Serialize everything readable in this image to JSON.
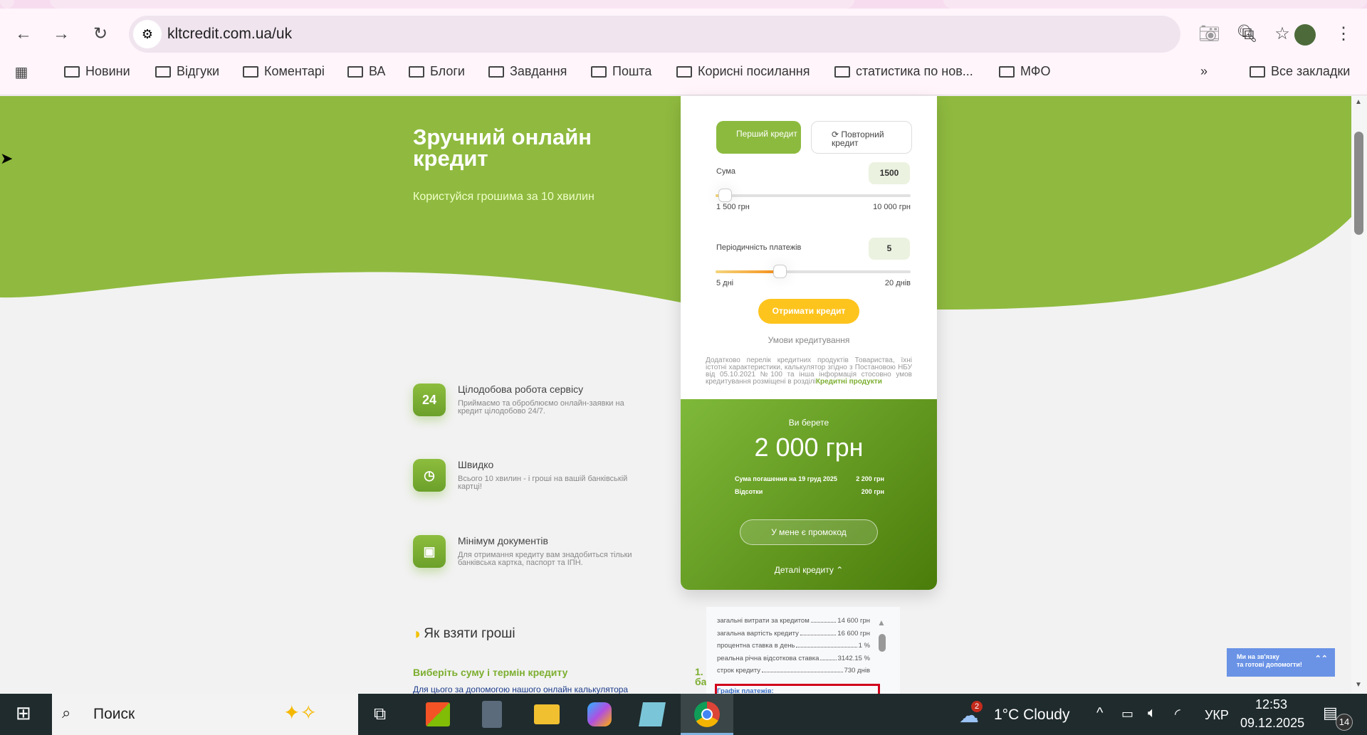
{
  "browser": {
    "url": "kltcredit.com.ua/uk",
    "bookmarks": [
      "Новини",
      "Відгуки",
      "Коментарі",
      "ВА",
      "Блоги",
      "Завдання",
      "Пошта",
      "Корисні посилання",
      "статистика по нов...",
      "МФО"
    ],
    "all_bookmarks": "Все закладки",
    "more": "»"
  },
  "hero": {
    "title": "Зручний онлайн кредит",
    "subtitle": "Користуйся грошима за 10 хвилин",
    "brand_color": "#8fba3f"
  },
  "features": [
    {
      "title": "Цілодобова робота сервісу",
      "desc": "Приймаємо та оброблюємо онлайн-заявки на кредит цілодобово 24/7.",
      "icon": "24h-icon",
      "glyph": "24"
    },
    {
      "title": "Швидко",
      "desc": "Всього 10 хвилин - і гроші на вашій банківській картці!",
      "icon": "fast-clock-icon",
      "glyph": "◷"
    },
    {
      "title": "Мінімум документів",
      "desc": "Для отримання кредиту вам знадобиться тільки банківська картка, паспорт та ІПН.",
      "icon": "document-icon",
      "glyph": "▣"
    }
  ],
  "how": {
    "title": "Як взяти гроші",
    "step_title": "Виберіть суму і термін кредиту",
    "step_text": "Для цього за допомогою нашого онлайн калькулятора",
    "step_num": "1.",
    "step_cut": "ба"
  },
  "calc": {
    "tab_first": "Перший кредит",
    "tab_repeat": "⟳ Повторний кредит",
    "amount_label": "Сума",
    "amount_value": "1500",
    "amount_min": "1 500 грн",
    "amount_max": "10 000 грн",
    "amount_fraction": 0,
    "period_label": "Періодичність платежів",
    "period_value": "5",
    "period_min": "5 дні",
    "period_max": "20 днів",
    "period_fraction": 0.3,
    "get_button": "Отримати кредит",
    "terms_link": "Умови кредитування",
    "disclaimer": "Додатково перелік кредитних продуктів Товариства, їхні істотні характеристики, калькулятор згідно з Постановою НБУ від 05.10.2021 №100 та інша інформація стосовно умов кредитування розміщені в розділі",
    "disclaimer_link": "Кредитні продукти",
    "you_take": "Ви берете",
    "amount_total": "2 000 грн",
    "repay_label": "Сума погашення на 19 груд 2025",
    "repay_value": "2 200 грн",
    "interest_label": "Відсотки",
    "interest_value": "200 грн",
    "promo_button": "У мене є промокод",
    "details_toggle": "Деталі кредиту ⌃"
  },
  "details": [
    {
      "label": "загальні витрати за кредитом",
      "value": "14 600 грн"
    },
    {
      "label": "загальна вартість кредиту",
      "value": "16 600 грн"
    },
    {
      "label": "процентна ставка в день",
      "value": "1 %"
    },
    {
      "label": "реальна річна відсоткова ставка",
      "value": "3142.15 %"
    },
    {
      "label": "строк кредиту",
      "value": "730 днів"
    }
  ],
  "details_schedule": "Графік платежів:",
  "chat": {
    "line1": "Ми на зв'язку",
    "line2": "та готові допомогти!"
  },
  "taskbar": {
    "search": "Поиск",
    "weather": "1°C  Cloudy",
    "weather_badge": "2",
    "lang": "УКР",
    "time": "12:53",
    "date": "09.12.2025",
    "notifications": "14"
  }
}
